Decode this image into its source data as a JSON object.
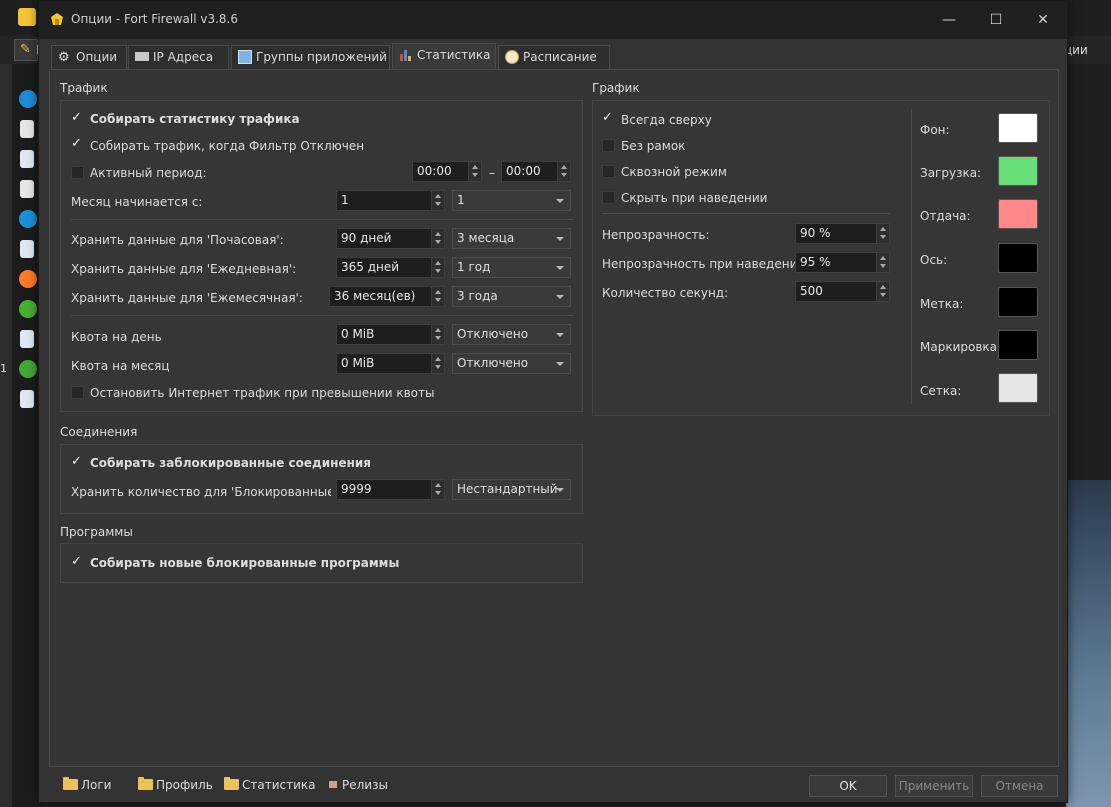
{
  "background": {
    "toolbar_text": "И",
    "right_text": "ции",
    "left_marker": "1"
  },
  "window": {
    "title": "Опции - Fort Firewall v3.8.6",
    "minimize": "—",
    "maximize": "☐",
    "close": "✕"
  },
  "tabs": [
    {
      "label": "Опции",
      "icon": "gear-icon"
    },
    {
      "label": "IP Адреса",
      "icon": "network-card-icon"
    },
    {
      "label": "Группы приложений",
      "icon": "windows-icon"
    },
    {
      "label": "Статистика",
      "icon": "bar-chart-icon",
      "active": true
    },
    {
      "label": "Расписание",
      "icon": "alarm-clock-icon"
    }
  ],
  "traffic": {
    "section_title": "Трафик",
    "collect_stats": {
      "label": "Собирать статистику трафика",
      "checked": true
    },
    "collect_when_filter_off": {
      "label": "Собирать трафик, когда Фильтр Отключен",
      "checked": true
    },
    "active_period": {
      "label": "Активный период:",
      "checked": false,
      "from": "00:00",
      "dash": "–",
      "to": "00:00"
    },
    "month_start": {
      "label": "Месяц начинается с:",
      "value": "1",
      "combo": "1"
    },
    "keep_hourly": {
      "label": "Хранить данные для 'Почасовая':",
      "value": "90 дней",
      "combo": "3 месяца"
    },
    "keep_daily": {
      "label": "Хранить данные для 'Ежедневная':",
      "value": "365 дней",
      "combo": "1 год"
    },
    "keep_monthly": {
      "label": "Хранить данные для 'Ежемесячная':",
      "value": "36 месяц(ев)",
      "combo": "3 года"
    },
    "quota_day": {
      "label": "Квота на день",
      "value": "0 MiB",
      "combo": "Отключено"
    },
    "quota_month": {
      "label": "Квота на месяц",
      "value": "0 MiB",
      "combo": "Отключено"
    },
    "stop_on_quota": {
      "label": "Остановить Интернет трафик при превышении квоты",
      "checked": false
    }
  },
  "connections": {
    "section_title": "Соединения",
    "collect_blocked": {
      "label": "Собирать заблокированные соединения",
      "checked": true
    },
    "keep_count": {
      "label": "Хранить количество для 'Блокированные сое",
      "value": "9999",
      "combo": "Нестандартный"
    }
  },
  "programs": {
    "section_title": "Программы",
    "collect_new_blocked": {
      "label": "Собирать новые блокированные программы",
      "checked": true
    }
  },
  "graph": {
    "section_title": "График",
    "always_on_top": {
      "label": "Всегда сверху",
      "checked": true
    },
    "frameless": {
      "label": "Без рамок",
      "checked": false
    },
    "click_through": {
      "label": "Сквозной режим",
      "checked": false
    },
    "hide_on_hover": {
      "label": "Скрыть при наведении",
      "checked": false
    },
    "opacity": {
      "label": "Непрозрачность:",
      "value": "90 %"
    },
    "hover_opacity": {
      "label": "Непрозрачность при наведении:",
      "value": "95 %"
    },
    "seconds": {
      "label": "Количество секунд:",
      "value": "500"
    },
    "colors": [
      {
        "label": "Фон:",
        "color": "#ffffff"
      },
      {
        "label": "Загрузка:",
        "color": "#66dd77"
      },
      {
        "label": "Отдача:",
        "color": "#ff8888"
      },
      {
        "label": "Ось:",
        "color": "#000000"
      },
      {
        "label": "Метка:",
        "color": "#000000"
      },
      {
        "label": "Маркировка:",
        "color": "#000000"
      },
      {
        "label": "Сетка:",
        "color": "#e4e4e4"
      }
    ]
  },
  "footer": {
    "logs": "Логи",
    "profile": "Профиль",
    "statistics": "Статистика",
    "releases": "Релизы",
    "ok": "OK",
    "apply": "Применить",
    "cancel": "Отмена"
  }
}
